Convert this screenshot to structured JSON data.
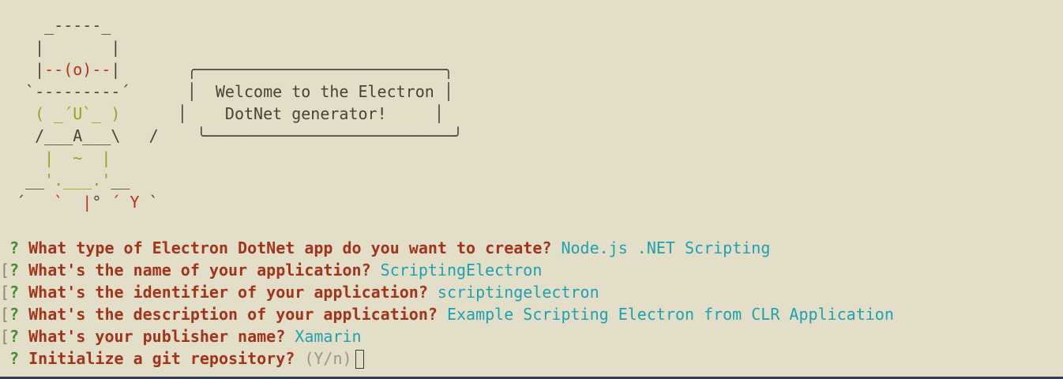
{
  "ascii_art": {
    "l1": "   _-----_",
    "l2": "  |       |",
    "l3a": "  |",
    "l3b": "--(o)--",
    "l3c": "|",
    "l3d": "       ╭──────────────────────────╮",
    "l4": " `---------´      │  Welcome to the Electron │",
    "l5a": "  ",
    "l5b": "( _´U`_ )",
    "l5c": "      │    DotNet generator!     │",
    "l6a": "  /___",
    "l6b": "A",
    "l6c": "___\\   /",
    "l6d": "    ╰──────────────────────────╯",
    "l7a": "   ",
    "l7b": "|  ~  |",
    "l8a": " __",
    "l8b": "'.___.'",
    "l8c": "__",
    "l9a": "´   ",
    "l9b": "`  |",
    "l9c": "° ",
    "l9d": "´ Y",
    "l9e": " `"
  },
  "prompts": [
    {
      "prefix": " ",
      "mark": "?",
      "question": "What type of Electron DotNet app do you want to create?",
      "answer": "Node.js .NET Scripting"
    },
    {
      "prefix": "[",
      "mark": "?",
      "question": "What's the name of your application?",
      "answer": "ScriptingElectron"
    },
    {
      "prefix": "[",
      "mark": "?",
      "question": "What's the identifier of your application?",
      "answer": "scriptingelectron"
    },
    {
      "prefix": "[",
      "mark": "?",
      "question": "What's the description of your application?",
      "answer": "Example Scripting Electron from CLR Application"
    },
    {
      "prefix": "[",
      "mark": "?",
      "question": "What's your publisher name?",
      "answer": "Xamarin"
    },
    {
      "prefix": " ",
      "mark": "?",
      "question": "Initialize a git repository?",
      "hint": "(Y/n)"
    }
  ],
  "colors": {
    "background": "#e3dec8",
    "question": "#a2341c",
    "answer": "#1ea1b0",
    "mark": "#3f8f2f",
    "hat_stripe": "#b83219",
    "face": "#9aa11e"
  }
}
